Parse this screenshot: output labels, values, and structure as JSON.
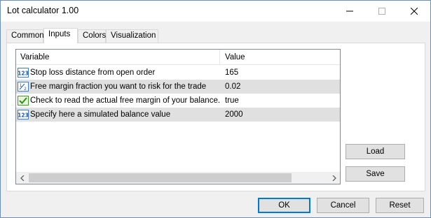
{
  "window": {
    "title": "Lot calculator 1.00"
  },
  "tabs": [
    {
      "label": "Common"
    },
    {
      "label": "Inputs"
    },
    {
      "label": "Colors"
    },
    {
      "label": "Visualization"
    }
  ],
  "active_tab": "Inputs",
  "table": {
    "headers": {
      "variable": "Variable",
      "value": "Value"
    },
    "rows": [
      {
        "variable": "Stop loss distance from open order",
        "value": "165",
        "icon": "integer-icon"
      },
      {
        "variable": "Free margin fraction you want to risk for the trade",
        "value": "0.02",
        "icon": "fraction-icon"
      },
      {
        "variable": "Check to read the actual free margin of your balance...",
        "value": "true",
        "icon": "boolean-icon"
      },
      {
        "variable": "Specify here a simulated balance value",
        "value": "2000",
        "icon": "integer-icon"
      }
    ]
  },
  "side_buttons": {
    "load": "Load",
    "save": "Save"
  },
  "footer": {
    "ok": "OK",
    "cancel": "Cancel",
    "reset": "Reset"
  },
  "colors": {
    "accent": "#0078d7",
    "row_alt": "#e0e0e0"
  }
}
